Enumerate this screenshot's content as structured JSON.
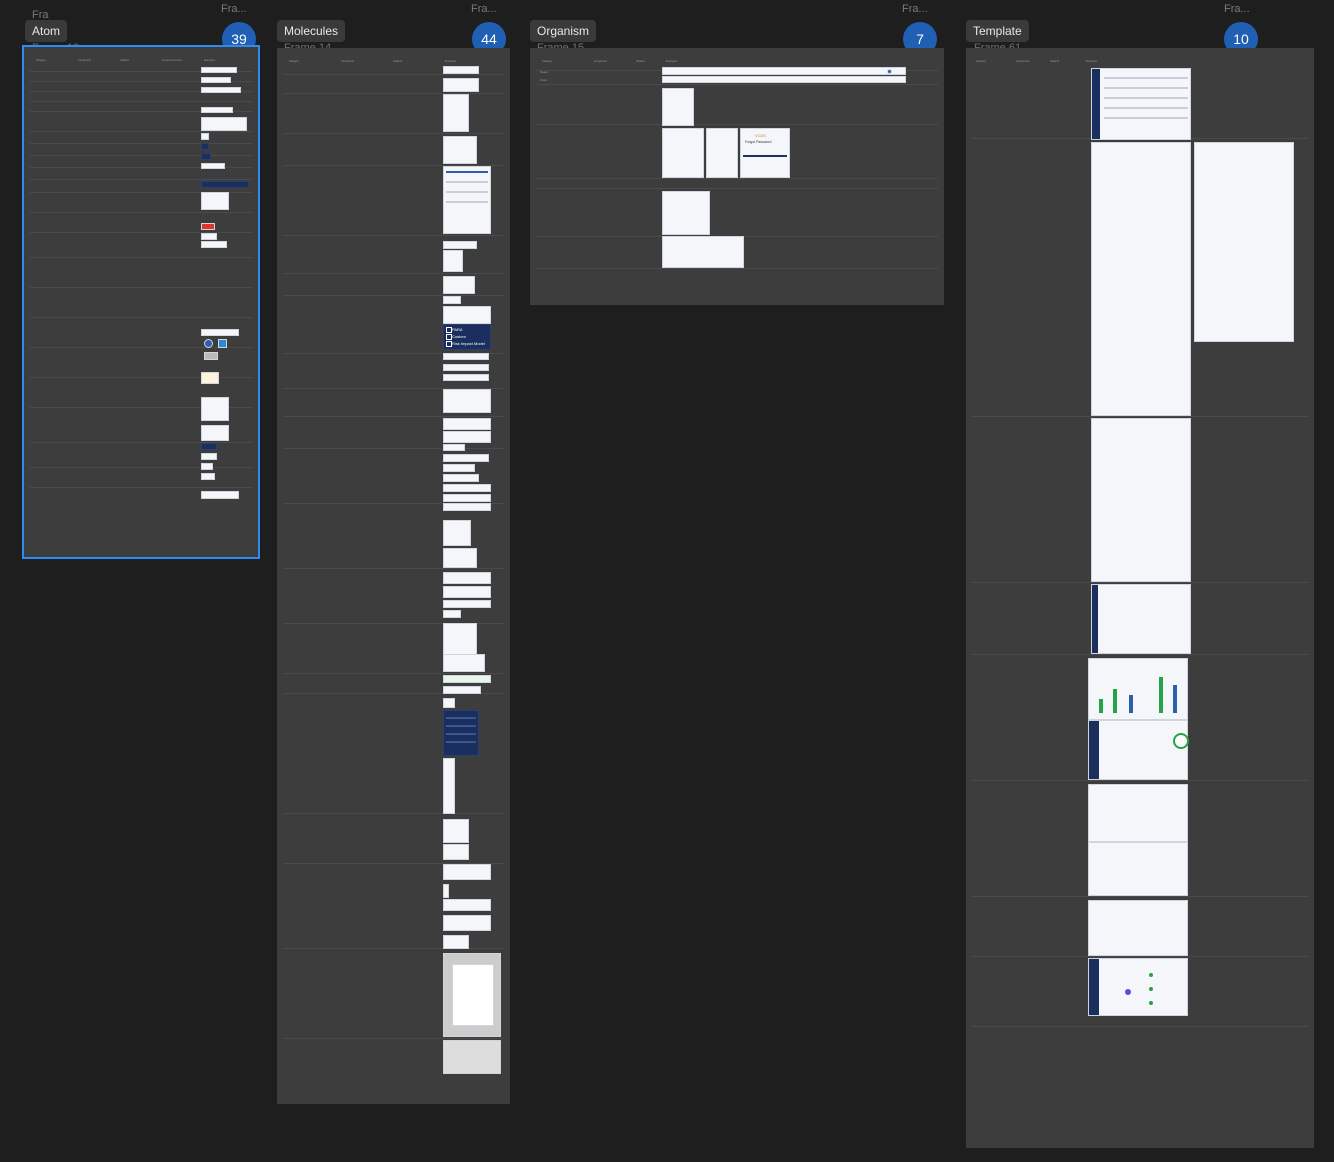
{
  "frames": [
    {
      "id": "atom",
      "top_label": "Fra...",
      "chip": "Atom",
      "frame_name": "Frame 12",
      "count": "39"
    },
    {
      "id": "molecules",
      "top_label": "Fra...",
      "chip": "Molecules",
      "frame_name": "Frame 14",
      "count": "44"
    },
    {
      "id": "organism",
      "top_label": "Fra...",
      "chip": "Organism",
      "frame_name": "Frame 15",
      "count": "7"
    },
    {
      "id": "template",
      "top_label": "Fra...",
      "chip": "Template",
      "frame_name": "Frame 61",
      "count": "10"
    }
  ],
  "atom_header": {
    "category": "Category",
    "component": "Component",
    "variants": "Variants",
    "component_used": "Component Used",
    "examples": "Examples"
  },
  "molecule_header": {
    "category": "Category",
    "component": "Component",
    "variants": "Variants",
    "examples": "Examples"
  },
  "organism_header": {
    "category": "Category",
    "component": "Component",
    "variants": "Variants",
    "examples": "Examples"
  },
  "template_header": {
    "category": "Category",
    "component": "Component",
    "variants": "Variants",
    "examples": "Examples"
  },
  "molecule_checkboxes": [
    "PARA",
    "Custom",
    "Risk Impact Model"
  ],
  "organism_rows": [
    "Header",
    "Forgot Password",
    "VCAS",
    "Footer"
  ],
  "selection_color": "#2d8cf0",
  "badge_color": "#1f5fb4"
}
